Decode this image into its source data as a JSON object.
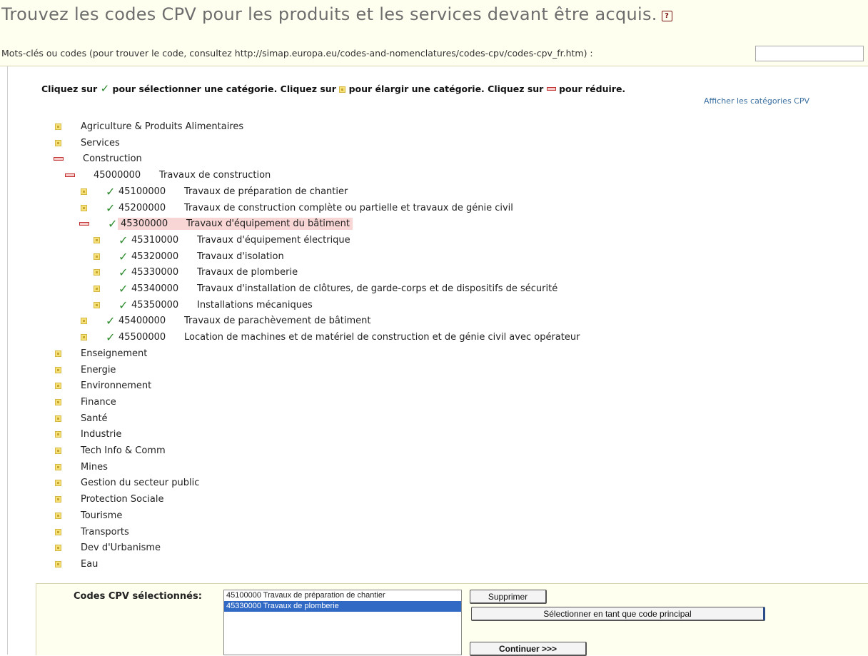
{
  "header": {
    "title": "Trouvez les codes CPV pour les produits et les services devant être acquis.",
    "help_icon": "?",
    "keywords_label": "Mots-clés ou codes (pour trouver le code, consultez http://simap.europa.eu/codes-and-nomenclatures/codes-cpv/codes-cpv_fr.htm) :",
    "keywords_value": ""
  },
  "instructions": {
    "part1": "Cliquez sur",
    "part2": "pour sélectionner une catégorie.  Cliquez sur",
    "part3": "pour élargir une catégorie. Cliquez sur",
    "part4": "pour réduire.",
    "check_glyph": "✓"
  },
  "show_categories_link": "Afficher les catégories CPV",
  "tree": {
    "check_glyph": "✓",
    "rows": [
      {
        "level": 0,
        "state": "expand",
        "check": false,
        "code": "",
        "label": "Agriculture & Produits Alimentaires"
      },
      {
        "level": 0,
        "state": "expand",
        "check": false,
        "code": "",
        "label": "Services"
      },
      {
        "level": 0,
        "state": "collapse",
        "check": false,
        "code": "",
        "label": "Construction"
      },
      {
        "level": 1,
        "state": "collapse",
        "check": false,
        "code": "45000000",
        "label": "Travaux de construction"
      },
      {
        "level": 2,
        "state": "expand",
        "check": true,
        "code": "45100000",
        "label": "Travaux de préparation de chantier"
      },
      {
        "level": 2,
        "state": "expand",
        "check": true,
        "code": "45200000",
        "label": "Travaux de construction complète ou partielle et travaux de génie civil"
      },
      {
        "level": 2,
        "state": "collapse",
        "check": true,
        "code": "45300000",
        "label": "Travaux d'équipement du bâtiment",
        "highlight": true
      },
      {
        "level": 3,
        "state": "expand",
        "check": true,
        "code": "45310000",
        "label": "Travaux d'équipement électrique"
      },
      {
        "level": 3,
        "state": "expand",
        "check": true,
        "code": "45320000",
        "label": "Travaux d'isolation"
      },
      {
        "level": 3,
        "state": "expand",
        "check": true,
        "code": "45330000",
        "label": "Travaux de plomberie"
      },
      {
        "level": 3,
        "state": "expand",
        "check": true,
        "code": "45340000",
        "label": "Travaux d'installation de clôtures, de garde-corps et de dispositifs de sécurité"
      },
      {
        "level": 3,
        "state": "expand",
        "check": true,
        "code": "45350000",
        "label": "Installations mécaniques"
      },
      {
        "level": 2,
        "state": "expand",
        "check": true,
        "code": "45400000",
        "label": "Travaux de parachèvement de bâtiment"
      },
      {
        "level": 2,
        "state": "expand",
        "check": true,
        "code": "45500000",
        "label": "Location de machines et de matériel de construction et de génie civil avec opérateur"
      },
      {
        "level": 0,
        "state": "expand",
        "check": false,
        "code": "",
        "label": "Enseignement"
      },
      {
        "level": 0,
        "state": "expand",
        "check": false,
        "code": "",
        "label": "Energie"
      },
      {
        "level": 0,
        "state": "expand",
        "check": false,
        "code": "",
        "label": "Environnement"
      },
      {
        "level": 0,
        "state": "expand",
        "check": false,
        "code": "",
        "label": "Finance"
      },
      {
        "level": 0,
        "state": "expand",
        "check": false,
        "code": "",
        "label": "Santé"
      },
      {
        "level": 0,
        "state": "expand",
        "check": false,
        "code": "",
        "label": "Industrie"
      },
      {
        "level": 0,
        "state": "expand",
        "check": false,
        "code": "",
        "label": "Tech Info & Comm"
      },
      {
        "level": 0,
        "state": "expand",
        "check": false,
        "code": "",
        "label": "Mines"
      },
      {
        "level": 0,
        "state": "expand",
        "check": false,
        "code": "",
        "label": "Gestion du secteur public"
      },
      {
        "level": 0,
        "state": "expand",
        "check": false,
        "code": "",
        "label": "Protection Sociale"
      },
      {
        "level": 0,
        "state": "expand",
        "check": false,
        "code": "",
        "label": "Tourisme"
      },
      {
        "level": 0,
        "state": "expand",
        "check": false,
        "code": "",
        "label": "Transports"
      },
      {
        "level": 0,
        "state": "expand",
        "check": false,
        "code": "",
        "label": "Dev d'Urbanisme"
      },
      {
        "level": 0,
        "state": "expand",
        "check": false,
        "code": "",
        "label": "Eau"
      }
    ]
  },
  "selection": {
    "label": "Codes CPV sélectionnés:",
    "items": [
      {
        "text": "45100000 Travaux de préparation de chantier",
        "active": false
      },
      {
        "text": "45330000 Travaux de plomberie",
        "active": true
      }
    ],
    "remove_button": "Supprimer",
    "primary_button": "Sélectionner en tant que code principal",
    "continue_button": "Continuer >>>"
  },
  "colors": {
    "accent_selection": "#316ac5",
    "check_green": "#2e8b2e",
    "highlight_row": "#f9d6d6",
    "band_background": "#fffff0"
  }
}
